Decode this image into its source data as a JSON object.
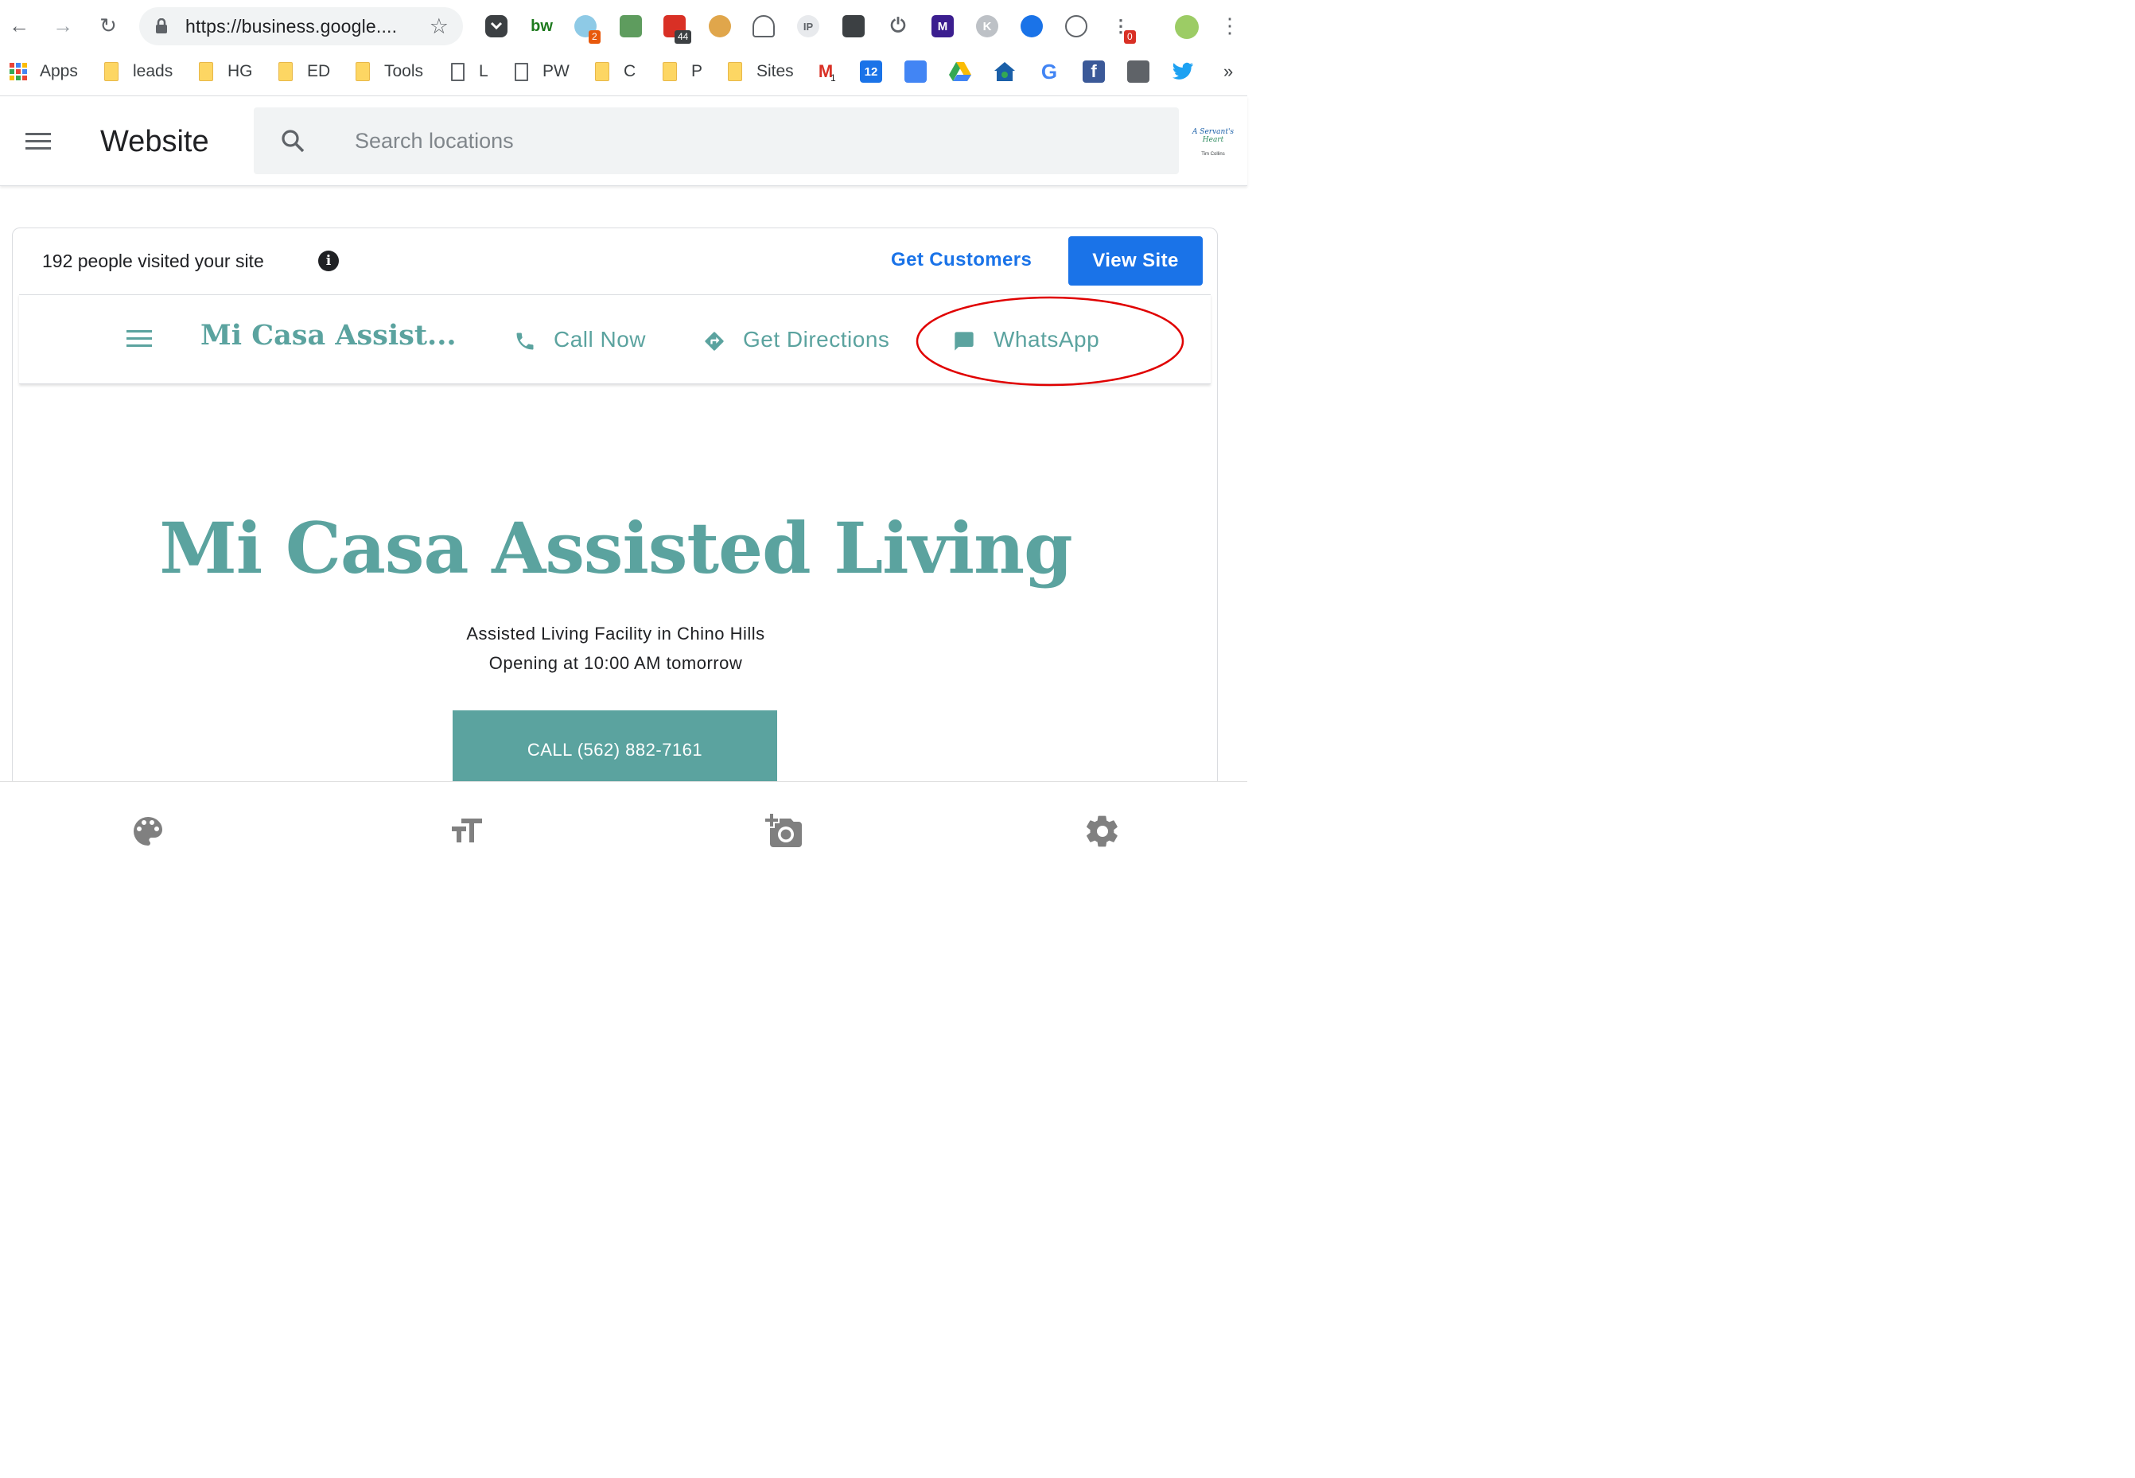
{
  "browser": {
    "url": "https://business.google....",
    "extensions": [
      {
        "icon": "pocket-icon"
      },
      {
        "icon": "bw-icon",
        "label": "bw"
      },
      {
        "icon": "lightbulb-icon",
        "badge": "2"
      },
      {
        "icon": "flag-icon"
      },
      {
        "icon": "calendar-badge-icon",
        "badge": "44"
      },
      {
        "icon": "cookie-icon"
      },
      {
        "icon": "speedometer-icon"
      },
      {
        "icon": "ip-icon",
        "label": "IP"
      },
      {
        "icon": "dark-square-icon"
      },
      {
        "icon": "power-icon"
      },
      {
        "icon": "m-icon",
        "label": "M"
      },
      {
        "icon": "k-icon",
        "label": "K"
      },
      {
        "icon": "zoom-icon"
      },
      {
        "icon": "s-icon"
      },
      {
        "icon": "dots-icon",
        "badge": "0"
      },
      {
        "icon": "profile-avatar-icon"
      }
    ],
    "bookmarks": [
      {
        "label": "Apps",
        "type": "apps"
      },
      {
        "label": "leads",
        "type": "folder"
      },
      {
        "label": "HG",
        "type": "folder"
      },
      {
        "label": "ED",
        "type": "folder"
      },
      {
        "label": "Tools",
        "type": "folder"
      },
      {
        "label": "L",
        "type": "page"
      },
      {
        "label": "PW",
        "type": "page"
      },
      {
        "label": "C",
        "type": "folder"
      },
      {
        "label": "P",
        "type": "folder"
      },
      {
        "label": "Sites",
        "type": "folder"
      }
    ],
    "bookmark_icons": {
      "gmail_badge": "1",
      "calendar_day": "12",
      "more": "»"
    }
  },
  "app": {
    "title": "Website",
    "search_placeholder": "Search locations",
    "logo_lines": [
      "A Servant's",
      "Heart",
      "Tim Collins"
    ]
  },
  "card": {
    "visits": "192 people visited your site",
    "info_glyph": "i",
    "get_customers": "Get Customers",
    "view_site": "View Site"
  },
  "site": {
    "brand": "Mi Casa Assist...",
    "nav": {
      "call": "Call Now",
      "directions": "Get Directions",
      "whatsapp": "WhatsApp"
    },
    "hero_title": "Mi Casa Assisted Living",
    "subtitle": "Assisted Living Facility in Chino Hills",
    "hours": "Opening at 10:00 AM tomorrow",
    "call_button": "CALL (562) 882-7161"
  },
  "colors": {
    "accent": "#1a73e8",
    "site_teal": "#5ba39f",
    "annotation": "#e00000"
  }
}
